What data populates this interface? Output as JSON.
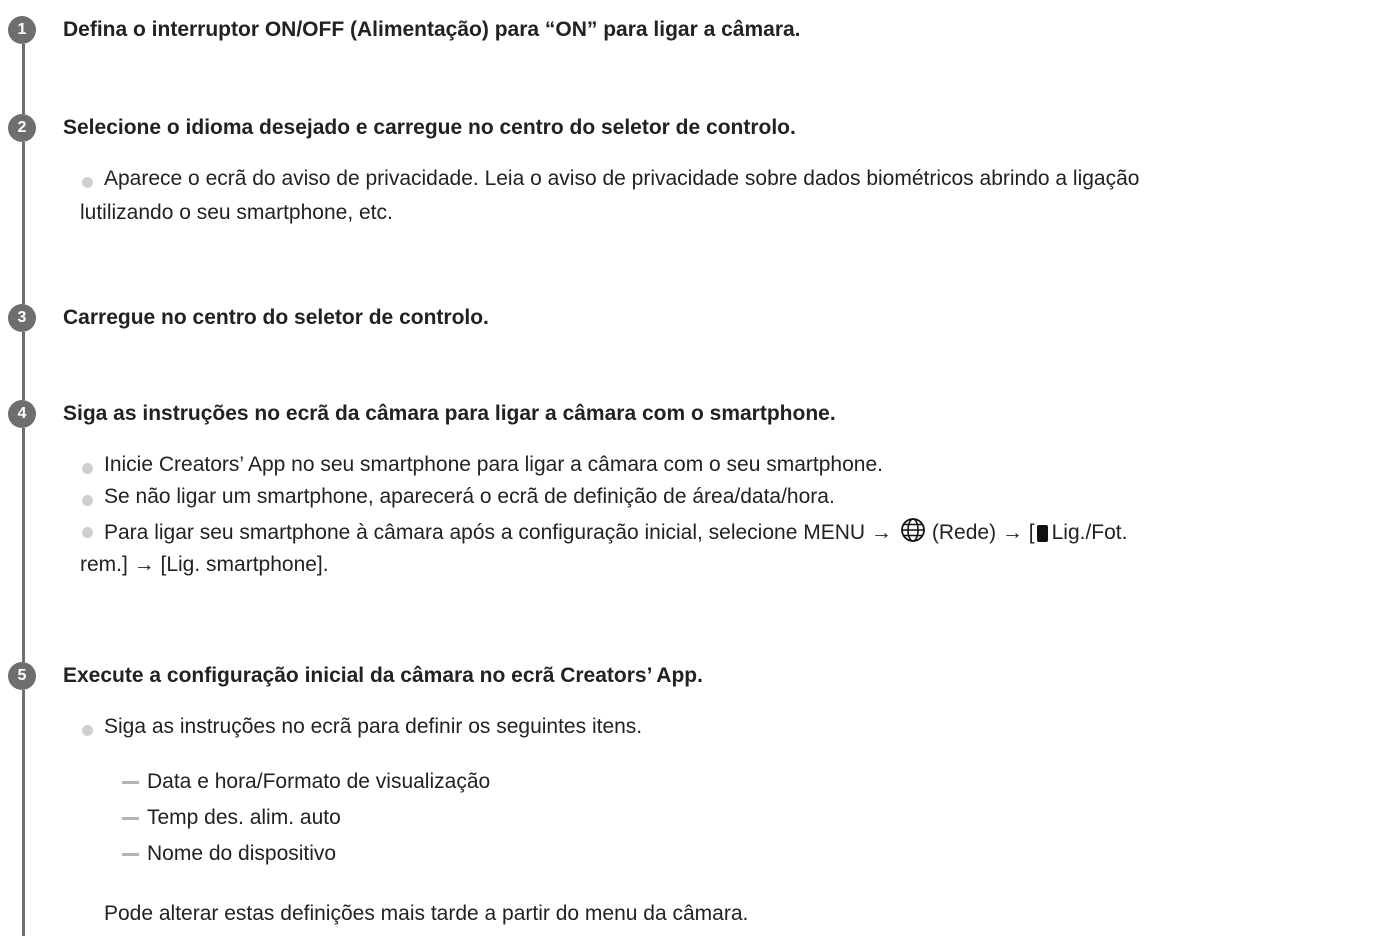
{
  "steps": [
    {
      "number": "1",
      "title": "Defina o interruptor ON/OFF (Alimentação) para “ON” para ligar a câmara."
    },
    {
      "number": "2",
      "title": "Selecione o idioma desejado e carregue no centro do seletor de controlo.",
      "bullets": [
        {
          "line1": "Aparece o ecrã do aviso de privacidade. Leia o aviso de privacidade sobre dados biométricos abrindo a ligação",
          "line2": "lutilizando o seu smartphone, etc."
        }
      ]
    },
    {
      "number": "3",
      "title": "Carregue no centro do seletor de controlo."
    },
    {
      "number": "4",
      "title": "Siga as instruções no ecrã da câmara para ligar a câmara com o smartphone.",
      "bullets": [
        {
          "line1": "Inicie Creators’ App no seu smartphone para ligar a câmara com o seu smartphone."
        },
        {
          "line1": "Se não ligar um smartphone, aparecerá o ecrã de definição de área/data/hora."
        },
        {
          "line1_a": "Para ligar seu smartphone à câmara após a configuração inicial, selecione MENU →",
          "line1_b": "(Rede) → [",
          "line1_c": "Lig./Fot.",
          "line2": "rem.] → [Lig. smartphone]."
        }
      ]
    },
    {
      "number": "5",
      "title": "Execute a configuração inicial da câmara no ecrã Creators’ App.",
      "bullets": [
        {
          "line1": "Siga as instruções no ecrã para definir os seguintes itens."
        }
      ],
      "subitems": [
        "Data e hora/Formato de visualização",
        "Temp des. alim. auto",
        "Nome do dispositivo"
      ],
      "note": "Pode alterar estas definições mais tarde a partir do menu da câmara."
    }
  ],
  "icons": {
    "globe": "network-globe-icon",
    "phone": "smartphone-icon"
  },
  "colors": {
    "step_circle": "#6e6e6e",
    "bullet": "#cfcfcf",
    "dash": "#b5b5b5",
    "text": "#222222"
  }
}
